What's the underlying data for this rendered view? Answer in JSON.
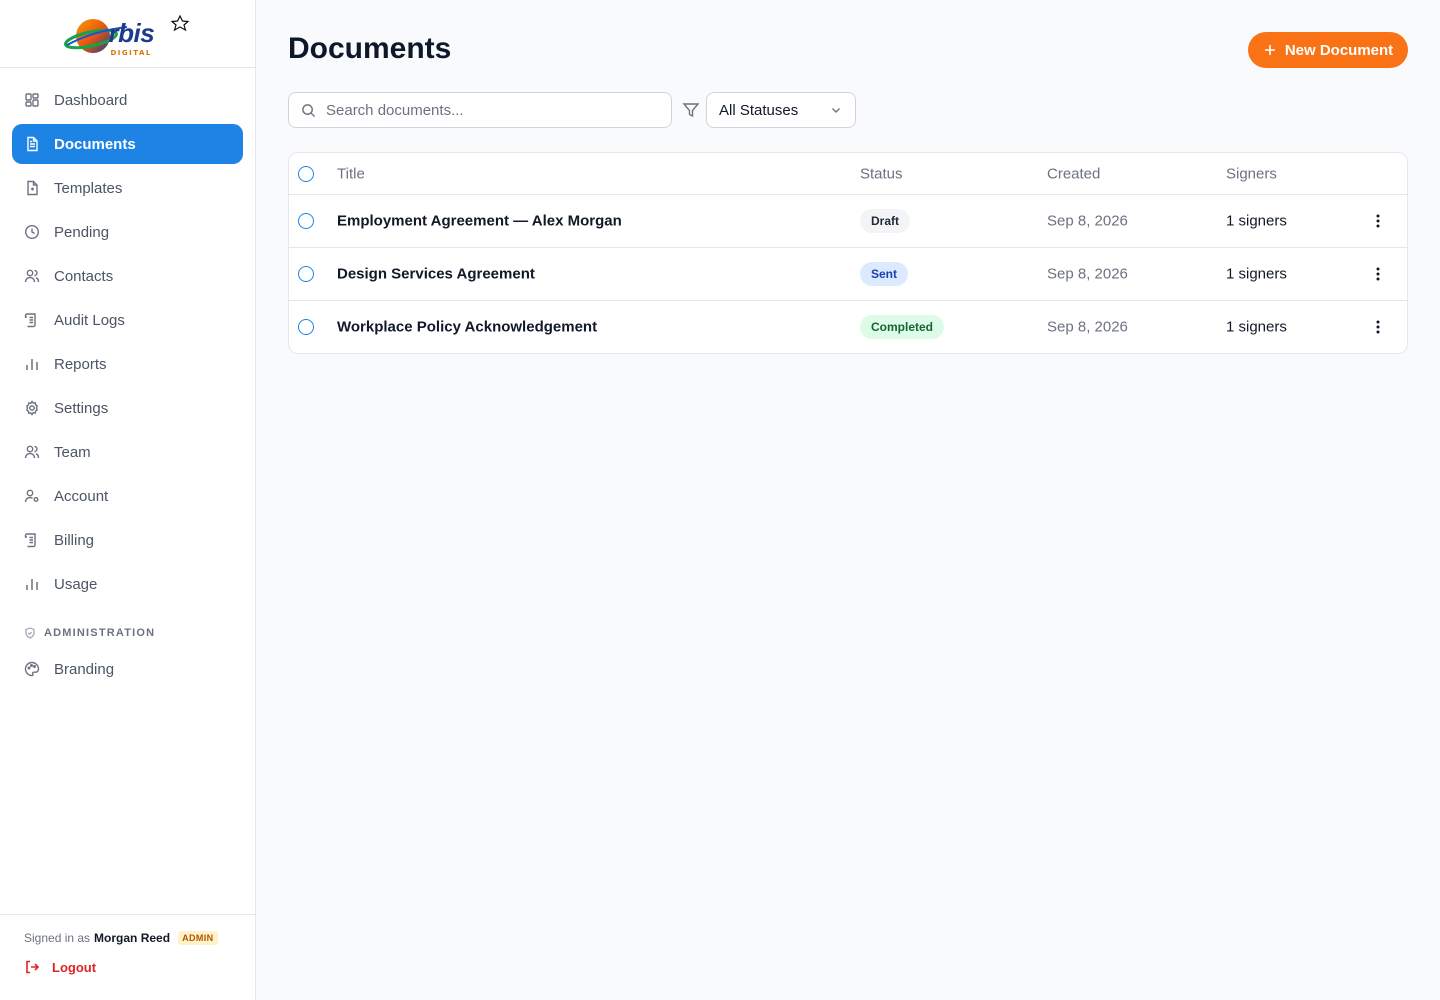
{
  "brand": {
    "logo_word": "rbis",
    "logo_sub": "DIGITAL"
  },
  "sidebar": {
    "items": [
      {
        "label": "Dashboard",
        "icon": "dashboard-icon"
      },
      {
        "label": "Documents",
        "icon": "document-icon",
        "active": true
      },
      {
        "label": "Templates",
        "icon": "template-icon"
      },
      {
        "label": "Pending",
        "icon": "clock-icon"
      },
      {
        "label": "Contacts",
        "icon": "users-icon"
      },
      {
        "label": "Audit Logs",
        "icon": "scroll-icon"
      },
      {
        "label": "Reports",
        "icon": "bar-chart-icon"
      },
      {
        "label": "Settings",
        "icon": "gear-icon"
      },
      {
        "label": "Team",
        "icon": "users-icon"
      },
      {
        "label": "Account",
        "icon": "user-cog-icon"
      },
      {
        "label": "Billing",
        "icon": "scroll-icon"
      },
      {
        "label": "Usage",
        "icon": "bar-chart-icon"
      }
    ],
    "section_label": "ADMINISTRATION",
    "admin_items": [
      {
        "label": "Branding",
        "icon": "palette-icon"
      }
    ],
    "footer": {
      "signed_in_prefix": "Signed in as",
      "user_name": "Morgan Reed",
      "role_badge": "ADMIN",
      "logout_label": "Logout"
    }
  },
  "main": {
    "title": "Documents",
    "new_button_label": "New Document",
    "search_placeholder": "Search documents...",
    "status_filter": "All Statuses",
    "table": {
      "columns": [
        "Title",
        "Status",
        "Created",
        "Signers"
      ],
      "rows": [
        {
          "title": "Employment Agreement — Alex Morgan",
          "status": "Draft",
          "created": "Sep 8, 2026",
          "signers": "1 signers"
        },
        {
          "title": "Design Services Agreement",
          "status": "Sent",
          "created": "Sep 8, 2026",
          "signers": "1 signers"
        },
        {
          "title": "Workplace Policy Acknowledgement",
          "status": "Completed",
          "created": "Sep 8, 2026",
          "signers": "1 signers"
        }
      ]
    }
  },
  "colors": {
    "accent": "#1d84e6",
    "primary_button": "#f97316",
    "status_draft_bg": "#f3f4f6",
    "status_draft_fg": "#1f2937",
    "status_sent_bg": "#dbeafe",
    "status_sent_fg": "#1e40af",
    "status_completed_bg": "#dcfce7",
    "status_completed_fg": "#166534"
  }
}
